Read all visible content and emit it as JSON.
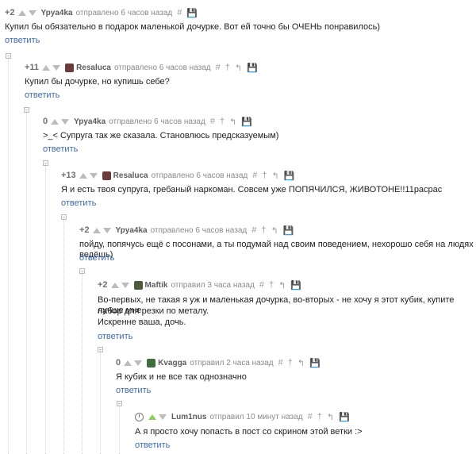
{
  "comments": [
    {
      "rating": "+2",
      "author": "Ypya4ka",
      "time": "отправлено 6 часов назад",
      "text": "Купил бы обязательно в подарок маленькой дочурке. Вот ей точно бы ОЧЕНЬ понравилось)",
      "reply": "ответить"
    },
    {
      "rating": "+11",
      "author": "Resaluca",
      "time": "отправлено 6 часов назад",
      "text": "Купил бы дочурке, но купишь себе?",
      "reply": "ответить"
    },
    {
      "rating": "0",
      "author": "Ypya4ka",
      "time": "отправлено 6 часов назад",
      "text": ">_< Супруга так же сказала. Становлюсь предсказуемым)",
      "reply": "ответить"
    },
    {
      "rating": "+13",
      "author": "Resaluca",
      "time": "отправлено 6 часов назад",
      "text": "Я и есть твоя супруга, гребаный наркоман. Совсем уже ПОПЯЧИЛСЯ, ЖИВОТОНЕ!!11расрас",
      "reply": "ответить"
    },
    {
      "rating": "+2",
      "author": "Ypya4ka",
      "time": "отправлено 6 часов назад",
      "text": "пойду, попячусь ещё с посонами, а ты подумай над своим поведением, нехорошо себя на людях ведёшь)",
      "reply": "ответить"
    },
    {
      "rating": "+2",
      "author": "Maftik",
      "time": "отправил 3 часа назад",
      "text_lines": [
        "Во-первых, не такая я уж и маленькая дочурка, во-вторых - не хочу я этот кубик, купите лучше мне",
        "набор для резки по металу.",
        "Искренне ваша, дочь."
      ],
      "reply": "ответить"
    },
    {
      "rating": "0",
      "author": "Kvagga",
      "time": "отправил 2 часа назад",
      "text": "Я кубик и не все так однозначно",
      "reply": "ответить"
    },
    {
      "author": "Lum1nus",
      "time": "отправил 10 минут назад",
      "text": "А я просто хочу попасть в пост со скрином этой ветки :>",
      "reply": "ответить"
    }
  ],
  "icons": {
    "hash": "#",
    "pin": "†",
    "reply_arrow": "↰",
    "save": "💾"
  },
  "colors": {
    "link": "#3d6bb5",
    "vote_up_active": "#8bcf57",
    "vote_neutral": "#bcbcbc"
  }
}
